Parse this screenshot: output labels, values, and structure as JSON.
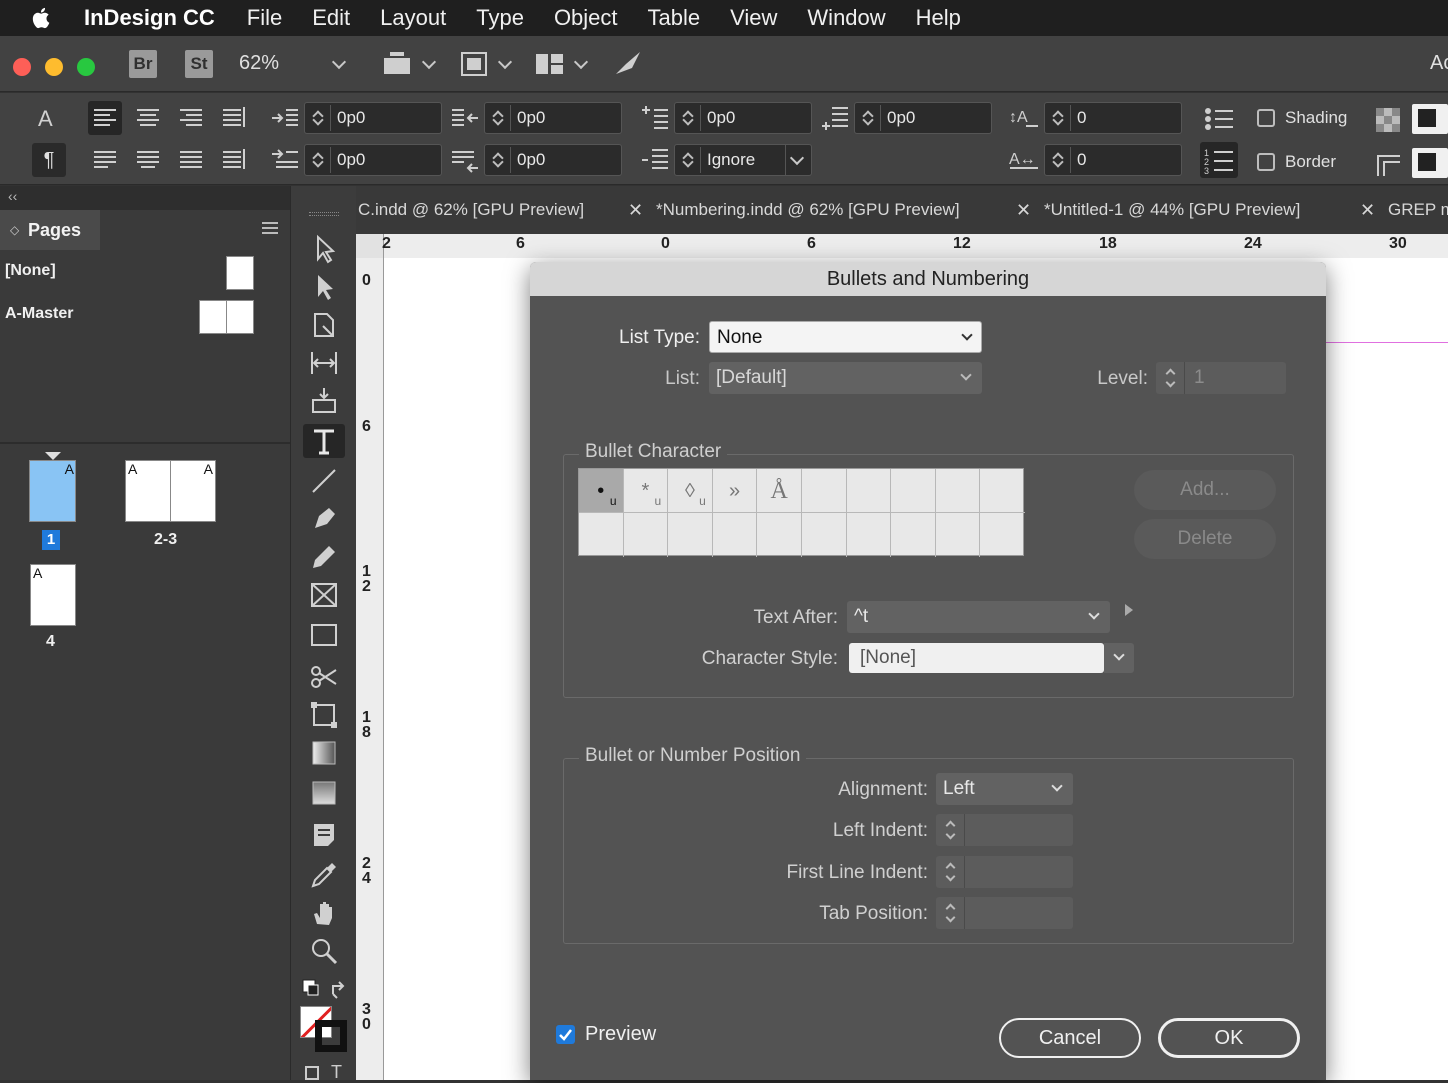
{
  "menubar": {
    "app_name": "InDesign CC",
    "items": [
      "File",
      "Edit",
      "Layout",
      "Type",
      "Object",
      "Table",
      "View",
      "Window",
      "Help"
    ]
  },
  "control": {
    "bridge_badge": "Br",
    "stock_badge": "St",
    "zoom": "62%",
    "right_partial": "Ac",
    "fields": {
      "left_indent": "0p0",
      "right_indent": "0p0",
      "first_line_indent": "0p0",
      "last_line_indent": "0p0",
      "space_before": "0p0",
      "space_after": "0p0",
      "drop_cap_lines": "0",
      "drop_cap_chars": "0",
      "align_to_grid": "Ignore"
    },
    "shading_label": "Shading",
    "border_label": "Border"
  },
  "pages_panel": {
    "title": "Pages",
    "masters": [
      "[None]",
      "A-Master"
    ],
    "pages": [
      {
        "label": "1",
        "master": "A"
      },
      {
        "label": "2-3",
        "master": "A"
      },
      {
        "label": "4",
        "master": "A"
      }
    ]
  },
  "doc_tabs": [
    "C.indd @ 62% [GPU Preview]",
    "*Numbering.indd @ 62% [GPU Preview]",
    "*Untitled-1 @ 44% [GPU Preview]",
    "GREP m"
  ],
  "ruler": {
    "top": [
      "2",
      "6",
      "0",
      "6",
      "12",
      "18",
      "24",
      "30"
    ],
    "left": [
      "0",
      "6",
      "12",
      "18",
      "24",
      "30"
    ]
  },
  "dialog": {
    "title": "Bullets and Numbering",
    "list_type_label": "List Type:",
    "list_type_value": "None",
    "list_label": "List:",
    "list_value": "[Default]",
    "level_label": "Level:",
    "level_value": "1",
    "bullet_group_title": "Bullet Character",
    "bullet_chars": [
      "•",
      "*",
      "◊",
      "»",
      "Å"
    ],
    "add_button": "Add...",
    "delete_button": "Delete",
    "text_after_label": "Text After:",
    "text_after_value": "^t",
    "char_style_label": "Character Style:",
    "char_style_value": "[None]",
    "position_group_title": "Bullet or Number Position",
    "alignment_label": "Alignment:",
    "alignment_value": "Left",
    "left_indent_label": "Left Indent:",
    "first_line_indent_label": "First Line Indent:",
    "tab_position_label": "Tab Position:",
    "preview_label": "Preview",
    "cancel_button": "Cancel",
    "ok_button": "OK"
  },
  "colors": {
    "menubar": "#1f1f1f",
    "panel": "#424242",
    "dialog": "#535353",
    "selected_page": "#89c4f4",
    "accent": "#1f7adb"
  }
}
